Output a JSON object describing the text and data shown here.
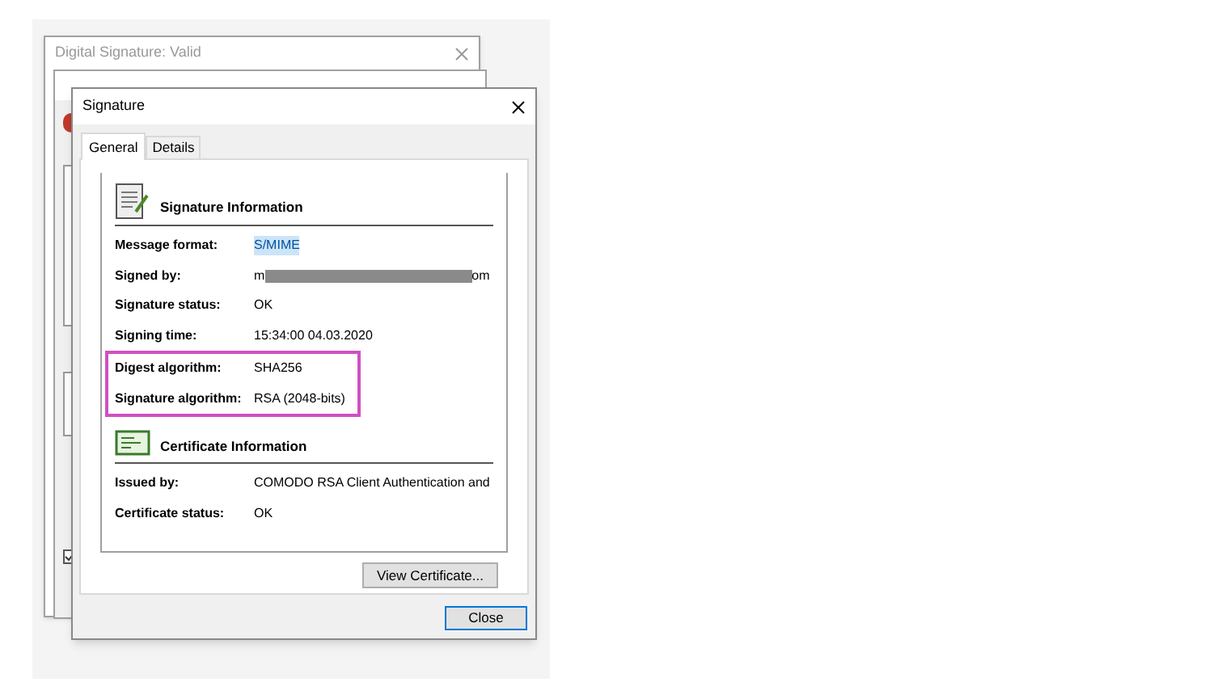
{
  "back_window": {
    "title": "Digital Signature: Valid"
  },
  "background_checkbox": {
    "checked": true
  },
  "window": {
    "title": "Signature"
  },
  "tabs": [
    {
      "label": "General",
      "selected": true
    },
    {
      "label": "Details",
      "selected": false
    }
  ],
  "signature_information": {
    "heading": "Signature Information",
    "fields": [
      {
        "label": "Message format:",
        "value": "S/MIME",
        "selected": true,
        "highlighted": false
      },
      {
        "label": "Signed by:",
        "value_start": "m",
        "value_end": "om",
        "redacted": true,
        "selected": false,
        "highlighted": false
      },
      {
        "label": "Signature status:",
        "value": "OK",
        "selected": false,
        "highlighted": false
      },
      {
        "label": "Signing time:",
        "value": "15:34:00 04.03.2020",
        "selected": false,
        "highlighted": false
      },
      {
        "label": "Digest algorithm:",
        "value": "SHA256",
        "selected": false,
        "highlighted": true
      },
      {
        "label": "Signature algorithm:",
        "value": "RSA (2048-bits)",
        "selected": false,
        "highlighted": true
      }
    ]
  },
  "certificate_information": {
    "heading": "Certificate Information",
    "fields": [
      {
        "label": "Issued by:",
        "value": "COMODO RSA Client Authentication and"
      },
      {
        "label": "Certificate status:",
        "value": "OK"
      }
    ]
  },
  "buttons": [
    "View Certificate...",
    "Close"
  ]
}
